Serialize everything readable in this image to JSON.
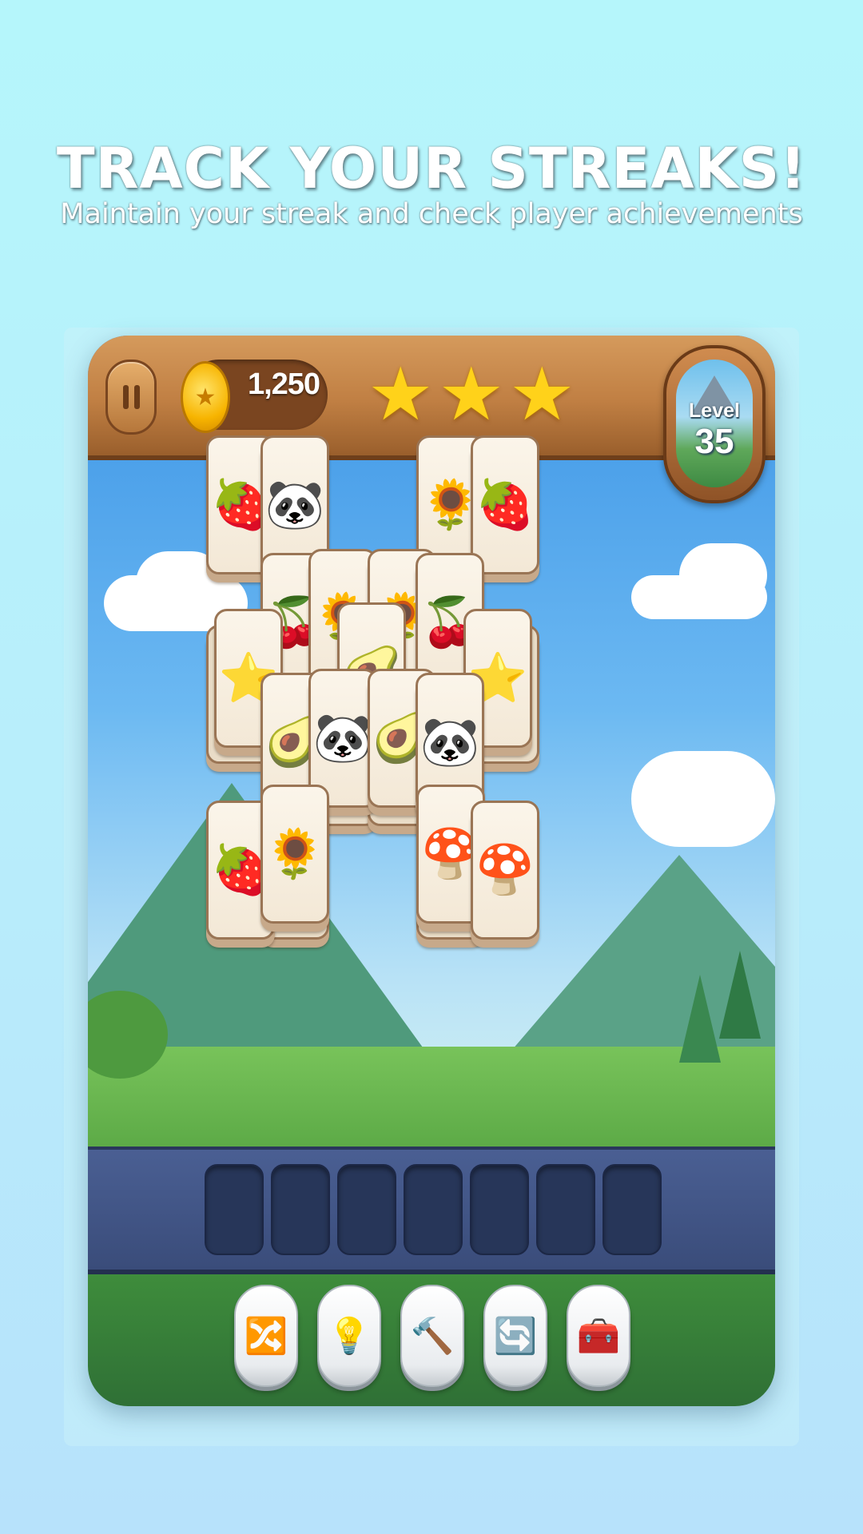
{
  "promo": {
    "headline": "TRACK YOUR STREAKS!",
    "subheadline": "Maintain your streak and check player achievements"
  },
  "hud": {
    "pause_icon": "pause-icon",
    "coin_icon": "coin-star-icon",
    "coins": "1,250",
    "stars_earned": 3,
    "stars_total": 3,
    "level_label": "Level",
    "level_number": "35"
  },
  "board": {
    "tiles": [
      {
        "icon": "strawberry-icon",
        "glyph": "🍓"
      },
      {
        "icon": "panda-icon",
        "glyph": "🐼"
      },
      {
        "icon": "sunflower-icon",
        "glyph": "🌻"
      },
      {
        "icon": "strawberry-icon",
        "glyph": "🍓"
      },
      {
        "icon": "cherries-icon",
        "glyph": "🍒"
      },
      {
        "icon": "sunflower-icon",
        "glyph": "🌻"
      },
      {
        "icon": "sunflower-icon",
        "glyph": "🌻"
      },
      {
        "icon": "cherries-icon",
        "glyph": "🍒"
      },
      {
        "icon": "star-face-icon",
        "glyph": "⭐"
      },
      {
        "icon": "avocado-icon",
        "glyph": "🥑"
      },
      {
        "icon": "star-face-icon",
        "glyph": "⭐"
      },
      {
        "icon": "avocado-icon",
        "glyph": "🥑"
      },
      {
        "icon": "panda-icon",
        "glyph": "🐼"
      },
      {
        "icon": "avocado-icon",
        "glyph": "🥑"
      },
      {
        "icon": "panda-icon",
        "glyph": "🐼"
      },
      {
        "icon": "strawberry-icon",
        "glyph": "🍓"
      },
      {
        "icon": "sunflower-icon",
        "glyph": "🌻"
      },
      {
        "icon": "mushroom-icon",
        "glyph": "🍄"
      },
      {
        "icon": "mushroom-icon",
        "glyph": "🍄"
      }
    ]
  },
  "tray": {
    "slots_total": 7,
    "slots_filled": 0
  },
  "tools": [
    {
      "icon": "shuffle-icon",
      "glyph": "🔀"
    },
    {
      "icon": "lightbulb-hint-icon",
      "glyph": "💡"
    },
    {
      "icon": "hammer-icon",
      "glyph": "🔨"
    },
    {
      "icon": "refresh-icon",
      "glyph": "🔄"
    },
    {
      "icon": "treasure-chest-icon",
      "glyph": "🧰"
    }
  ],
  "colors": {
    "background": "#b5f6fb",
    "wood": "#c07f43",
    "tray": "#3a4c7a",
    "tile_face": "#fbf5ea",
    "star": "#ffd21a"
  }
}
